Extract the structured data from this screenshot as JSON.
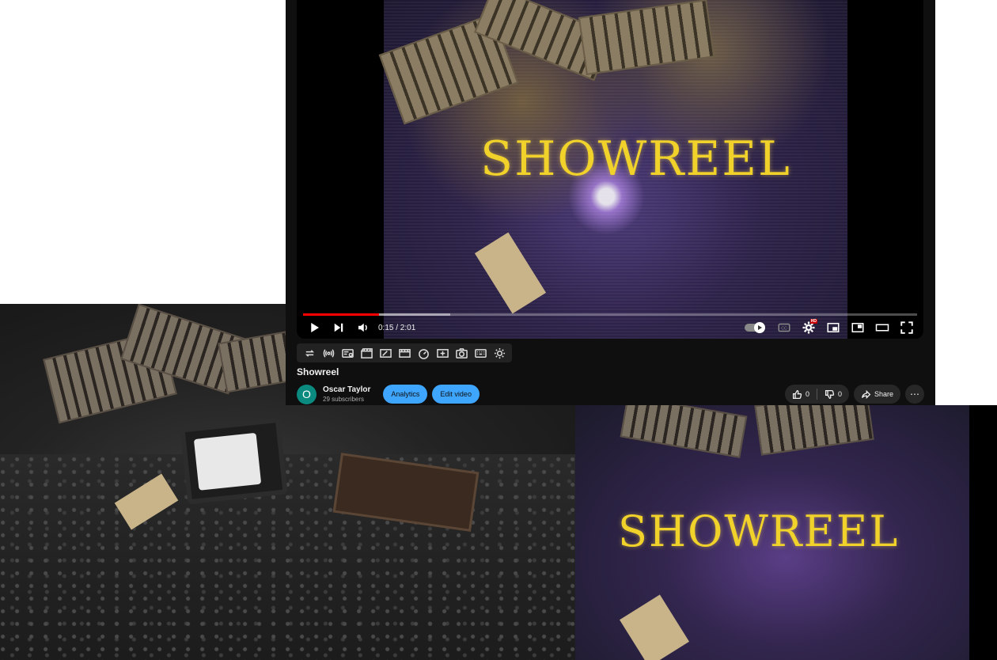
{
  "video": {
    "title_overlay": "SHOWREEL",
    "time_display": "0:15 / 2:01",
    "progress_played": 0.124,
    "progress_loaded": 0.24
  },
  "controls": {
    "icons": [
      "play-icon",
      "next-icon",
      "volume-icon",
      "autoplay-toggle",
      "captions-icon",
      "settings-icon",
      "miniplayer-icon",
      "theater-icon",
      "fullscreen-icon"
    ],
    "hd_badge": "HD",
    "cc_label": "CC"
  },
  "toolbar": {
    "icons": [
      "loop-icon",
      "cast-icon",
      "playlist-view-icon",
      "clapper-icon",
      "aspect-icon",
      "frames-icon",
      "speed-icon",
      "screenshot-plus-icon",
      "camera-icon",
      "keyboard-icon",
      "gear-icon"
    ]
  },
  "meta": {
    "video_title": "Showreel",
    "avatar_letter": "O",
    "channel_name": "Oscar Taylor",
    "subscribers": "29 subscribers",
    "analytics_label": "Analytics",
    "edit_label": "Edit video",
    "likes": "0",
    "dislikes": "0",
    "share_label": "Share",
    "more_label": "⋯"
  },
  "colors": {
    "accent_progress": "#ff0000",
    "button_blue": "#3ea6ff",
    "avatar_bg": "#0b8a80",
    "title_gold": "#f1d22a"
  }
}
